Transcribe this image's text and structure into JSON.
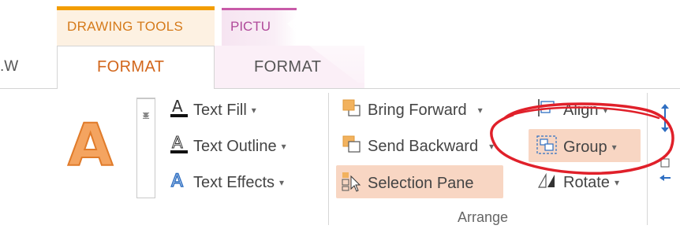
{
  "context_tabs": {
    "drawing_tools": "DRAWING TOOLS",
    "picture_tools": "PICTU"
  },
  "tabs": {
    "partial_left": ".W",
    "format_drawing": "FORMAT",
    "format_picture": "FORMAT"
  },
  "wordart": {
    "letter": "A"
  },
  "text_commands": {
    "text_fill": "Text Fill",
    "text_outline": "Text Outline",
    "text_effects": "Text Effects"
  },
  "arrange": {
    "bring_forward": "Bring Forward",
    "send_backward": "Send Backward",
    "selection_pane": "Selection Pane",
    "align": "Align",
    "group": "Group",
    "rotate": "Rotate",
    "group_label": "Arrange"
  },
  "colors": {
    "accent_orange": "#d2661b",
    "highlight": "#f8d6c3",
    "annotation_red": "#e0202a"
  }
}
